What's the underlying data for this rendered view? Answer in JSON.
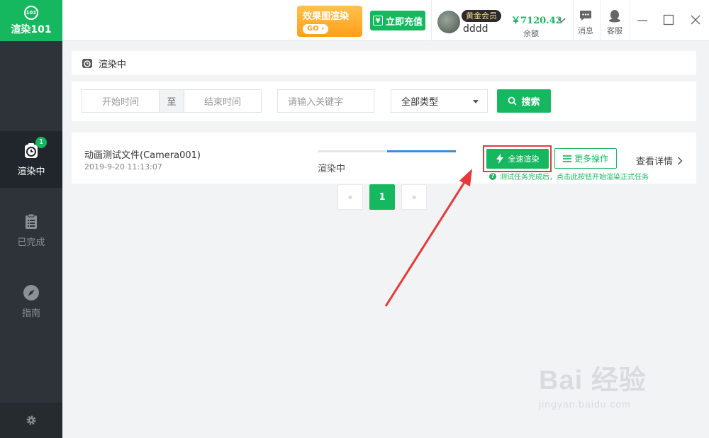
{
  "app": {
    "logo_text": "渲染101",
    "logo_mark": "101"
  },
  "sidebar": {
    "items": [
      {
        "label": "渲染中",
        "badge": "1",
        "icon": "clock-icon",
        "active": true
      },
      {
        "label": "已完成",
        "icon": "clipboard-icon",
        "active": false
      },
      {
        "label": "指南",
        "icon": "compass-icon",
        "active": false
      }
    ],
    "settings_icon": "gear-icon"
  },
  "topbar": {
    "promo": {
      "title": "效果图渲染",
      "go": "GO"
    },
    "recharge_label": "立即充值",
    "recharge_symbol": "¥",
    "vip_badge": "黄金会员",
    "username": "dddd",
    "balance_amount": "￥7120.42",
    "balance_label": "余额",
    "messages_label": "消息",
    "support_label": "客服"
  },
  "breadcrumb": {
    "title": "渲染中"
  },
  "filters": {
    "start_placeholder": "开始时间",
    "to_label": "至",
    "end_placeholder": "结束时间",
    "keyword_placeholder": "请输入关键字",
    "type_selected": "全部类型",
    "search_label": "搜索"
  },
  "task": {
    "name": "动画测试文件(Camera001)",
    "time": "2019-9-20 11:13:07",
    "progress": 0.5,
    "status": "渲染中",
    "full_render_label": "全速渲染",
    "more_ops_label": "更多操作",
    "details_label": "查看详情",
    "hint": "测试任务完成后，点击此按钮开始渲染正式任务"
  },
  "pagination": {
    "prev": "«",
    "current": "1",
    "next": "»"
  },
  "watermark": {
    "main": "Bai 经验",
    "url": "jingyan.baidu.com"
  },
  "colors": {
    "accent": "#16b85f",
    "sidebar": "#2d3338",
    "progress": "#3b8de0",
    "highlight": "#e23b3b"
  }
}
